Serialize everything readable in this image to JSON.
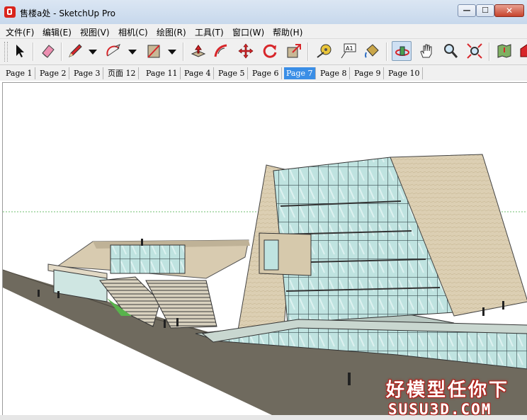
{
  "window": {
    "title": "售楼a处 - SketchUp Pro",
    "minimize_glyph": "—",
    "maximize_glyph": "☐",
    "close_glyph": "✕"
  },
  "menu": {
    "items": [
      {
        "label": "文件(F)"
      },
      {
        "label": "编辑(E)"
      },
      {
        "label": "视图(V)"
      },
      {
        "label": "相机(C)"
      },
      {
        "label": "绘图(R)"
      },
      {
        "label": "工具(T)"
      },
      {
        "label": "窗口(W)"
      },
      {
        "label": "帮助(H)"
      }
    ]
  },
  "toolbar": {
    "tools": [
      {
        "icon": "select-arrow-icon"
      },
      {
        "icon": "eraser-icon"
      },
      {
        "icon": "pencil-line-icon"
      },
      {
        "icon": "arc-icon"
      },
      {
        "icon": "rectangle-icon"
      },
      {
        "icon": "push-pull-icon"
      },
      {
        "icon": "follow-me-icon"
      },
      {
        "icon": "move-icon"
      },
      {
        "icon": "rotate-icon"
      },
      {
        "icon": "scale-icon"
      },
      {
        "icon": "tape-measure-icon"
      },
      {
        "icon": "text-icon"
      },
      {
        "icon": "paint-bucket-icon"
      },
      {
        "icon": "orbit-icon"
      },
      {
        "icon": "pan-hand-icon"
      },
      {
        "icon": "zoom-icon"
      },
      {
        "icon": "zoom-extents-icon"
      },
      {
        "icon": "map-icon"
      },
      {
        "icon": "warehouse-icon"
      }
    ],
    "text_tool_label": "A1",
    "active_tool": "orbit-icon"
  },
  "scene_tabs": [
    {
      "label": "Page 1"
    },
    {
      "label": "Page 2"
    },
    {
      "label": "Page 3"
    },
    {
      "label": "页面 12"
    },
    {
      "label": "Page 11"
    },
    {
      "label": "Page 4"
    },
    {
      "label": "Page 5"
    },
    {
      "label": "Page 6"
    },
    {
      "label": "Page 7",
      "active": true
    },
    {
      "label": "Page 8"
    },
    {
      "label": "Page 9"
    },
    {
      "label": "Page 10"
    }
  ],
  "watermark": {
    "line1": "好模型任你下",
    "line2": "SUSU3D.COM"
  },
  "colors": {
    "active_tab": "#3a8ee6",
    "ground": "#6f6a5e",
    "facade": "#d8cbb0",
    "glass": "#bfe3e0",
    "watermark_red": "#b21d17"
  }
}
